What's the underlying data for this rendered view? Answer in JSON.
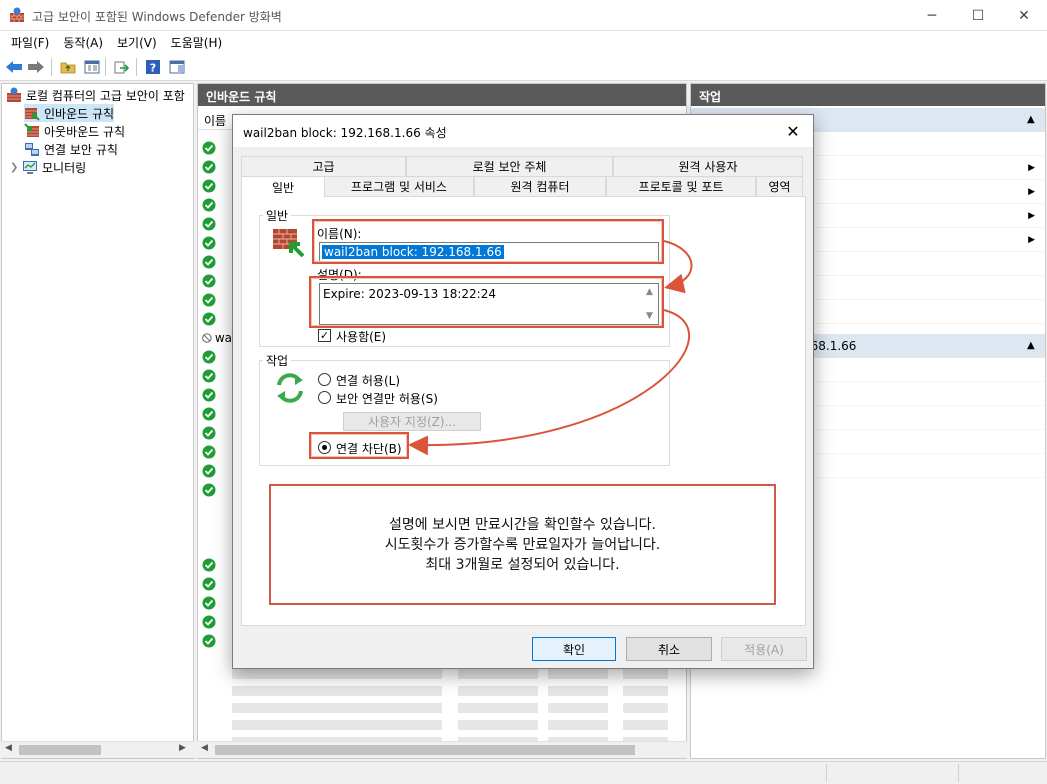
{
  "window": {
    "title": "고급 보안이 포함된 Windows Defender 방화벽",
    "min": "─",
    "max": "☐",
    "close": "✕"
  },
  "menu": [
    "파일(F)",
    "동작(A)",
    "보기(V)",
    "도움말(H)"
  ],
  "tree": {
    "root": "로컬 컴퓨터의 고급 보안이 포함",
    "items": [
      "인바운드 규칙",
      "아웃바운드 규칙",
      "연결 보안 규칙",
      "모니터링"
    ]
  },
  "middle": {
    "header": "인바운드 규칙",
    "col_name": "이름",
    "row_prefix": "wa"
  },
  "right": {
    "header": "작업",
    "section2": "168.1.66"
  },
  "dialog": {
    "title": "wail2ban block: 192.168.1.66 속성",
    "close": "✕",
    "tabs_top": [
      "고급",
      "로컬 보안 주체",
      "원격 사용자"
    ],
    "tabs_bottom": [
      "일반",
      "프로그램 및 서비스",
      "원격 컴퓨터",
      "프로토콜 및 포트",
      "영역"
    ],
    "general_group": "일반",
    "name_label": "이름(N):",
    "name_value": "wail2ban block: 192.168.1.66",
    "desc_label": "설명(D):",
    "desc_value": "Expire: 2023-09-13 18:22:24",
    "enabled_label": "사용함(E)",
    "action_group": "작업",
    "allow_label": "연결 허용(L)",
    "secure_label": "보안 연결만 허용(S)",
    "custom_button": "사용자 지정(Z)...",
    "block_label": "연결 차단(B)",
    "ok": "확인",
    "cancel": "취소",
    "apply": "적용(A)"
  },
  "note": {
    "line1": "설명에 보시면 만료시간을 확인할수 있습니다.",
    "line2": "시도횟수가 증가할수록 만료일자가 늘어납니다.",
    "line3": "최대 3개월로 설정되어 있습니다."
  },
  "colors": {
    "annotation": "#d9553a",
    "selection": "#0078d7",
    "check_green": "#1f9e35"
  }
}
